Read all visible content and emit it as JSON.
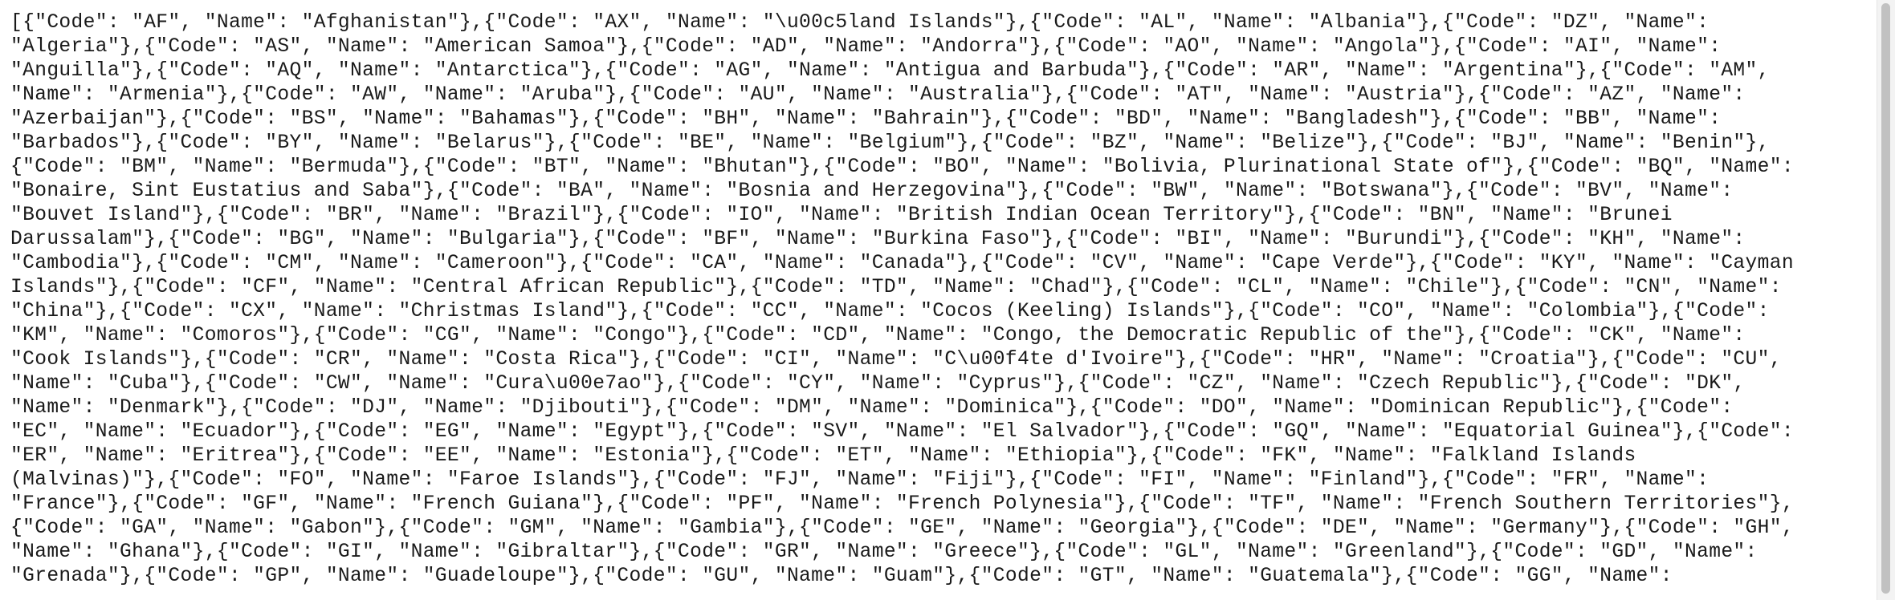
{
  "document": {
    "text": "[{\"Code\": \"AF\", \"Name\": \"Afghanistan\"},{\"Code\": \"AX\", \"Name\": \"\\u00c5land Islands\"},{\"Code\": \"AL\", \"Name\": \"Albania\"},{\"Code\": \"DZ\", \"Name\":\n\"Algeria\"},{\"Code\": \"AS\", \"Name\": \"American Samoa\"},{\"Code\": \"AD\", \"Name\": \"Andorra\"},{\"Code\": \"AO\", \"Name\": \"Angola\"},{\"Code\": \"AI\", \"Name\":\n\"Anguilla\"},{\"Code\": \"AQ\", \"Name\": \"Antarctica\"},{\"Code\": \"AG\", \"Name\": \"Antigua and Barbuda\"},{\"Code\": \"AR\", \"Name\": \"Argentina\"},{\"Code\": \"AM\",\n\"Name\": \"Armenia\"},{\"Code\": \"AW\", \"Name\": \"Aruba\"},{\"Code\": \"AU\", \"Name\": \"Australia\"},{\"Code\": \"AT\", \"Name\": \"Austria\"},{\"Code\": \"AZ\", \"Name\":\n\"Azerbaijan\"},{\"Code\": \"BS\", \"Name\": \"Bahamas\"},{\"Code\": \"BH\", \"Name\": \"Bahrain\"},{\"Code\": \"BD\", \"Name\": \"Bangladesh\"},{\"Code\": \"BB\", \"Name\":\n\"Barbados\"},{\"Code\": \"BY\", \"Name\": \"Belarus\"},{\"Code\": \"BE\", \"Name\": \"Belgium\"},{\"Code\": \"BZ\", \"Name\": \"Belize\"},{\"Code\": \"BJ\", \"Name\": \"Benin\"},\n{\"Code\": \"BM\", \"Name\": \"Bermuda\"},{\"Code\": \"BT\", \"Name\": \"Bhutan\"},{\"Code\": \"BO\", \"Name\": \"Bolivia, Plurinational State of\"},{\"Code\": \"BQ\", \"Name\":\n\"Bonaire, Sint Eustatius and Saba\"},{\"Code\": \"BA\", \"Name\": \"Bosnia and Herzegovina\"},{\"Code\": \"BW\", \"Name\": \"Botswana\"},{\"Code\": \"BV\", \"Name\":\n\"Bouvet Island\"},{\"Code\": \"BR\", \"Name\": \"Brazil\"},{\"Code\": \"IO\", \"Name\": \"British Indian Ocean Territory\"},{\"Code\": \"BN\", \"Name\": \"Brunei\nDarussalam\"},{\"Code\": \"BG\", \"Name\": \"Bulgaria\"},{\"Code\": \"BF\", \"Name\": \"Burkina Faso\"},{\"Code\": \"BI\", \"Name\": \"Burundi\"},{\"Code\": \"KH\", \"Name\":\n\"Cambodia\"},{\"Code\": \"CM\", \"Name\": \"Cameroon\"},{\"Code\": \"CA\", \"Name\": \"Canada\"},{\"Code\": \"CV\", \"Name\": \"Cape Verde\"},{\"Code\": \"KY\", \"Name\": \"Cayman\nIslands\"},{\"Code\": \"CF\", \"Name\": \"Central African Republic\"},{\"Code\": \"TD\", \"Name\": \"Chad\"},{\"Code\": \"CL\", \"Name\": \"Chile\"},{\"Code\": \"CN\", \"Name\":\n\"China\"},{\"Code\": \"CX\", \"Name\": \"Christmas Island\"},{\"Code\": \"CC\", \"Name\": \"Cocos (Keeling) Islands\"},{\"Code\": \"CO\", \"Name\": \"Colombia\"},{\"Code\":\n\"KM\", \"Name\": \"Comoros\"},{\"Code\": \"CG\", \"Name\": \"Congo\"},{\"Code\": \"CD\", \"Name\": \"Congo, the Democratic Republic of the\"},{\"Code\": \"CK\", \"Name\":\n\"Cook Islands\"},{\"Code\": \"CR\", \"Name\": \"Costa Rica\"},{\"Code\": \"CI\", \"Name\": \"C\\u00f4te d'Ivoire\"},{\"Code\": \"HR\", \"Name\": \"Croatia\"},{\"Code\": \"CU\",\n\"Name\": \"Cuba\"},{\"Code\": \"CW\", \"Name\": \"Cura\\u00e7ao\"},{\"Code\": \"CY\", \"Name\": \"Cyprus\"},{\"Code\": \"CZ\", \"Name\": \"Czech Republic\"},{\"Code\": \"DK\",\n\"Name\": \"Denmark\"},{\"Code\": \"DJ\", \"Name\": \"Djibouti\"},{\"Code\": \"DM\", \"Name\": \"Dominica\"},{\"Code\": \"DO\", \"Name\": \"Dominican Republic\"},{\"Code\":\n\"EC\", \"Name\": \"Ecuador\"},{\"Code\": \"EG\", \"Name\": \"Egypt\"},{\"Code\": \"SV\", \"Name\": \"El Salvador\"},{\"Code\": \"GQ\", \"Name\": \"Equatorial Guinea\"},{\"Code\":\n\"ER\", \"Name\": \"Eritrea\"},{\"Code\": \"EE\", \"Name\": \"Estonia\"},{\"Code\": \"ET\", \"Name\": \"Ethiopia\"},{\"Code\": \"FK\", \"Name\": \"Falkland Islands\n(Malvinas)\"},{\"Code\": \"FO\", \"Name\": \"Faroe Islands\"},{\"Code\": \"FJ\", \"Name\": \"Fiji\"},{\"Code\": \"FI\", \"Name\": \"Finland\"},{\"Code\": \"FR\", \"Name\":\n\"France\"},{\"Code\": \"GF\", \"Name\": \"French Guiana\"},{\"Code\": \"PF\", \"Name\": \"French Polynesia\"},{\"Code\": \"TF\", \"Name\": \"French Southern Territories\"},\n{\"Code\": \"GA\", \"Name\": \"Gabon\"},{\"Code\": \"GM\", \"Name\": \"Gambia\"},{\"Code\": \"GE\", \"Name\": \"Georgia\"},{\"Code\": \"DE\", \"Name\": \"Germany\"},{\"Code\": \"GH\",\n\"Name\": \"Ghana\"},{\"Code\": \"GI\", \"Name\": \"Gibraltar\"},{\"Code\": \"GR\", \"Name\": \"Greece\"},{\"Code\": \"GL\", \"Name\": \"Greenland\"},{\"Code\": \"GD\", \"Name\":\n\"Grenada\"},{\"Code\": \"GP\", \"Name\": \"Guadeloupe\"},{\"Code\": \"GU\", \"Name\": \"Guam\"},{\"Code\": \"GT\", \"Name\": \"Guatemala\"},{\"Code\": \"GG\", \"Name\":"
  }
}
